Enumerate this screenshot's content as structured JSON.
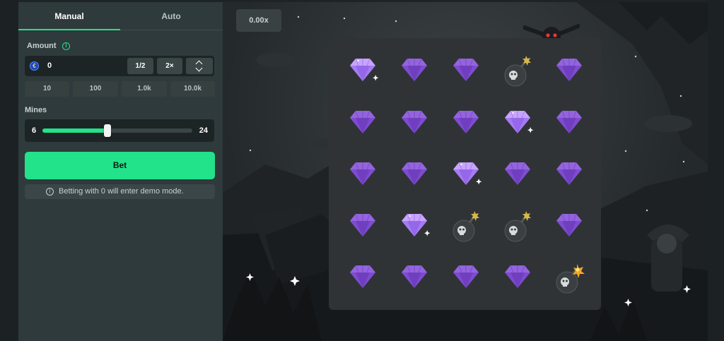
{
  "tabs": {
    "manual": "Manual",
    "auto": "Auto",
    "active": "Manual"
  },
  "amount": {
    "label": "Amount",
    "value": "0",
    "currency_icon": "coin-icon",
    "half_label": "1/2",
    "double_label": "2×"
  },
  "presets": [
    "10",
    "100",
    "1.0k",
    "10.0k"
  ],
  "mines": {
    "label": "Mines",
    "min": "6",
    "max": "24",
    "selected": 6,
    "range_min": 1,
    "range_max": 24
  },
  "bet_label": "Bet",
  "demo_note": "Betting with 0 will enter demo mode.",
  "multiplier": "0.00x",
  "board": {
    "rows": 5,
    "cols": 5,
    "tiles": [
      "gem-revealed",
      "gem",
      "gem",
      "mine",
      "gem",
      "gem",
      "gem",
      "gem",
      "gem-revealed",
      "gem",
      "gem",
      "gem",
      "gem-revealed",
      "gem",
      "gem",
      "gem",
      "gem-revealed",
      "mine",
      "mine",
      "gem",
      "gem",
      "gem",
      "gem",
      "gem",
      "mine-exploded"
    ]
  },
  "colors": {
    "accent": "#22e38a",
    "gem": "#7f4bd1",
    "gem_bright": "#a67bf2",
    "panel": "#2e3a3b"
  }
}
